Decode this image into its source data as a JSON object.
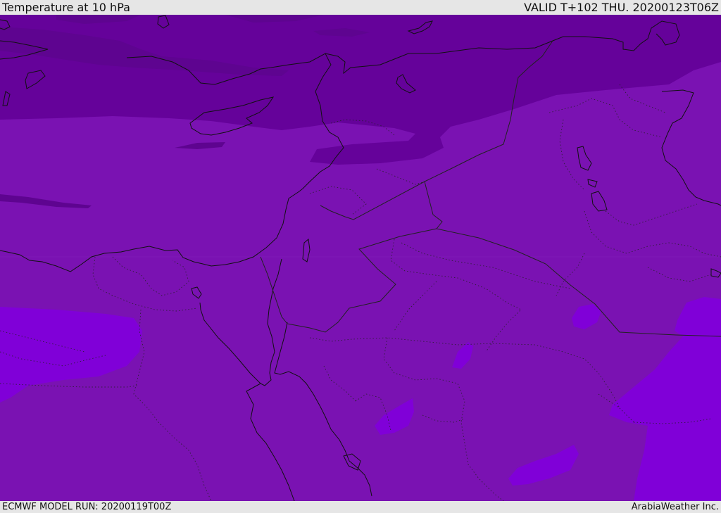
{
  "header": {
    "title": "Temperature at 10 hPa",
    "valid_time": "VALID T+102 THU. 20200123T06Z"
  },
  "footer": {
    "model_run": "ECMWF MODEL RUN: 20200119T00Z",
    "credit": "ArabiaWeather Inc."
  },
  "map": {
    "field": "temperature",
    "level": "10 hPa",
    "colors": {
      "band_darkest": "#5e0490",
      "band_dark": "#65029a",
      "band_base": "#7a12b2",
      "band_bright": "#8000d8",
      "coastline": "#111111",
      "border": "#222222"
    }
  }
}
